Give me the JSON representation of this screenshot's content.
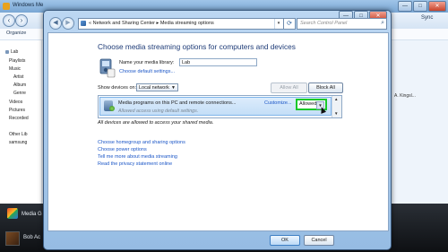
{
  "background_app": {
    "title": "Windows Me",
    "organize_label": "Organize",
    "sync_label": "Sync",
    "sidebar_items": [
      "Lab",
      "Playlists",
      "Music",
      "Artist",
      "Album",
      "Genre",
      "Videos",
      "Pictures",
      "Recorded",
      "Other Lib",
      "samsung"
    ],
    "right_tab_label": "",
    "right_text": "A. Kingsl...",
    "media_guide_label": "Media G",
    "artist_label": "Bob Ac"
  },
  "dialog": {
    "caption_buttons": [
      "—",
      "□",
      "✕"
    ],
    "address": {
      "root_arrow": "«",
      "crumb1": "Network and Sharing Center",
      "separator": "▸",
      "crumb2": "Media streaming options",
      "dropdown": "▾"
    },
    "refresh_glyph": "⟳",
    "search_placeholder": "Search Control Panel",
    "heading": "Choose media streaming options for computers and devices",
    "library_label": "Name your media library:",
    "library_value": "Lab",
    "default_settings_link": "Choose default settings...",
    "show_devices_label": "Show devices on:",
    "show_devices_value": "Local network",
    "allow_all_label": "Allow All",
    "block_all_label": "Block All",
    "device": {
      "name": "Media programs on this PC and remote connections...",
      "status": "Allowed access using default settings.",
      "customize_link": "Customize...",
      "permission_value": "Allowed"
    },
    "all_allowed_text": "All devices are allowed to access your shared media.",
    "links": [
      "Choose homegroup and sharing options",
      "Choose power options",
      "Tell me more about media streaming",
      "Read the privacy statement online"
    ],
    "ok_label": "OK",
    "cancel_label": "Cancel"
  },
  "colors": {
    "link": "#1b56c7",
    "heading": "#1e3b77",
    "highlight_border": "#18c82a"
  }
}
